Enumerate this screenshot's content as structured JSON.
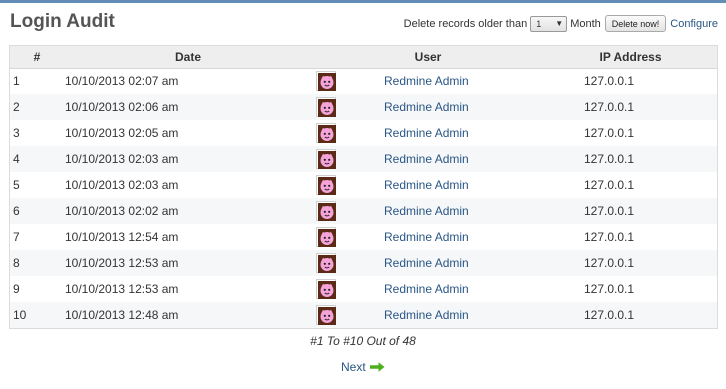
{
  "page": {
    "title": "Login Audit"
  },
  "controls": {
    "delete_prefix": "Delete records older than",
    "months_value": "1",
    "delete_suffix": "Month",
    "delete_button": "Delete now!",
    "configure_link": "Configure"
  },
  "table": {
    "headers": {
      "num": "#",
      "date": "Date",
      "user": "User",
      "ip": "IP Address"
    },
    "rows": [
      {
        "num": "1",
        "date": "10/10/2013 02:07 am",
        "user": "Redmine Admin",
        "ip": "127.0.0.1"
      },
      {
        "num": "2",
        "date": "10/10/2013 02:06 am",
        "user": "Redmine Admin",
        "ip": "127.0.0.1"
      },
      {
        "num": "3",
        "date": "10/10/2013 02:05 am",
        "user": "Redmine Admin",
        "ip": "127.0.0.1"
      },
      {
        "num": "4",
        "date": "10/10/2013 02:03 am",
        "user": "Redmine Admin",
        "ip": "127.0.0.1"
      },
      {
        "num": "5",
        "date": "10/10/2013 02:03 am",
        "user": "Redmine Admin",
        "ip": "127.0.0.1"
      },
      {
        "num": "6",
        "date": "10/10/2013 02:02 am",
        "user": "Redmine Admin",
        "ip": "127.0.0.1"
      },
      {
        "num": "7",
        "date": "10/10/2013 12:54 am",
        "user": "Redmine Admin",
        "ip": "127.0.0.1"
      },
      {
        "num": "8",
        "date": "10/10/2013 12:53 am",
        "user": "Redmine Admin",
        "ip": "127.0.0.1"
      },
      {
        "num": "9",
        "date": "10/10/2013 12:53 am",
        "user": "Redmine Admin",
        "ip": "127.0.0.1"
      },
      {
        "num": "10",
        "date": "10/10/2013 12:48 am",
        "user": "Redmine Admin",
        "ip": "127.0.0.1"
      }
    ]
  },
  "pagination": {
    "info": "#1 To #10 Out of 48",
    "next_label": "Next",
    "next_icon": "right-arrow-icon"
  },
  "colors": {
    "link": "#2a5685",
    "header_bg": "#eeeeee",
    "top_border": "#628db6",
    "next_arrow": "#4caf1e"
  }
}
